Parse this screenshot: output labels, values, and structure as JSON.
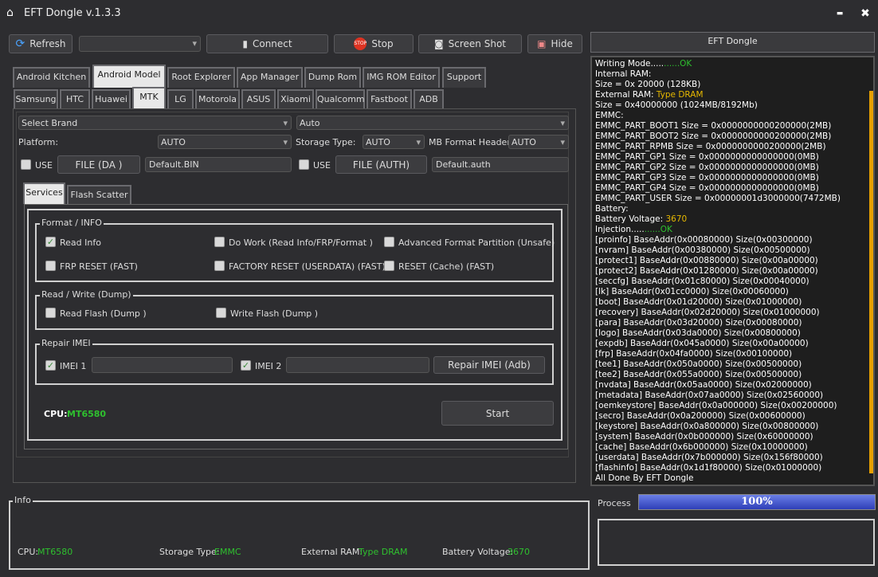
{
  "app": {
    "title": "EFT Dongle  v.1.3.3",
    "minimize": "▬",
    "close": "✖"
  },
  "toolbar": {
    "refresh": "Refresh",
    "port_value": "",
    "connect": "Connect",
    "stop": "Stop",
    "stop_icon_text": "STOP",
    "screenshot": "Screen Shot",
    "hide": "Hide"
  },
  "tabs": [
    "Android Kitchen",
    "Android Model",
    "Root Explorer",
    "App Manager",
    "Dump Rom",
    "IMG ROM Editor",
    "Support"
  ],
  "brand_tabs": [
    "Samsung",
    "HTC",
    "Huawei",
    "MTK",
    "LG",
    "Motorola",
    "ASUS",
    "Xiaomi",
    "Qualcomm",
    "Fastboot",
    "ADB"
  ],
  "form": {
    "brand": "Select Brand",
    "auto1": "Auto",
    "platform_label": "Platform:",
    "platform": "AUTO",
    "storage_label": "Storage Type:",
    "storage": "AUTO",
    "mbformat_label": "MB Format Header",
    "mbformat": "AUTO",
    "use1": "USE",
    "file_da": "FILE (DA )",
    "da_value": "Default.BIN",
    "use2": "USE",
    "file_auth": "FILE (AUTH)",
    "auth_value": "Default.auth"
  },
  "subtabs": [
    "Services",
    "Flash Scatter"
  ],
  "format": {
    "title": "Format / INFO",
    "read_info": "Read Info",
    "do_work": "Do Work (Read Info/FRP/Format )",
    "adv": "Advanced Format Partition (Unsafe)",
    "frp": "FRP RESET (FAST)",
    "factory": "FACTORY RESET (USERDATA) (FAST)",
    "reset": "RESET (Cache) (FAST)"
  },
  "rw": {
    "title": "Read / Write (Dump)",
    "read": "Read Flash (Dump )",
    "write": "Write Flash (Dump )"
  },
  "imei": {
    "title": "Repair IMEI",
    "imei1": "IMEI 1",
    "imei2": "IMEI 2",
    "repair": "Repair IMEI (Adb)"
  },
  "cpu": {
    "label": "CPU:",
    "value": "MT6580"
  },
  "start": "Start",
  "panel_title": "EFT Dongle",
  "log": [
    [
      "Writing Mode......",
      "",
      "......OK",
      "g"
    ],
    [
      "Internal RAM:",
      "",
      "",
      ""
    ],
    [
      "Size = 0x 20000 (128KB)",
      "",
      "",
      ""
    ],
    [
      "External RAM: ",
      "",
      "Type DRAM",
      "y"
    ],
    [
      "Size = 0x40000000 (1024MB/8192Mb)",
      "",
      "",
      ""
    ],
    [
      "EMMC:",
      "",
      "",
      ""
    ],
    [
      "EMMC_PART_BOOT1 Size = 0x0000000000200000(2MB)",
      "",
      "",
      ""
    ],
    [
      "EMMC_PART_BOOT2 Size = 0x0000000000200000(2MB)",
      "",
      "",
      ""
    ],
    [
      "EMMC_PART_RPMB Size = 0x0000000000200000(2MB)",
      "",
      "",
      ""
    ],
    [
      "EMMC_PART_GP1 Size = 0x0000000000000000(0MB)",
      "",
      "",
      ""
    ],
    [
      "EMMC_PART_GP2 Size = 0x0000000000000000(0MB)",
      "",
      "",
      ""
    ],
    [
      "EMMC_PART_GP3 Size = 0x0000000000000000(0MB)",
      "",
      "",
      ""
    ],
    [
      "EMMC_PART_GP4 Size = 0x0000000000000000(0MB)",
      "",
      "",
      ""
    ],
    [
      "EMMC_PART_USER Size = 0x00000001d3000000(7472MB)",
      "",
      "",
      ""
    ],
    [
      "Battery:",
      "",
      "",
      ""
    ],
    [
      "Battery Voltage: ",
      "",
      "3670",
      "y"
    ],
    [
      "Injection......",
      "",
      "......OK",
      "g"
    ],
    [
      "[proinfo] BaseAddr(0x00080000) Size(0x00300000)",
      "",
      "",
      ""
    ],
    [
      "[nvram] BaseAddr(0x00380000) Size(0x00500000)",
      "",
      "",
      ""
    ],
    [
      "[protect1] BaseAddr(0x00880000) Size(0x00a00000)",
      "",
      "",
      ""
    ],
    [
      "[protect2] BaseAddr(0x01280000) Size(0x00a00000)",
      "",
      "",
      ""
    ],
    [
      "[seccfg] BaseAddr(0x01c80000) Size(0x00040000)",
      "",
      "",
      ""
    ],
    [
      "[lk] BaseAddr(0x01cc0000) Size(0x00060000)",
      "",
      "",
      ""
    ],
    [
      "[boot] BaseAddr(0x01d20000) Size(0x01000000)",
      "",
      "",
      ""
    ],
    [
      "[recovery] BaseAddr(0x02d20000) Size(0x01000000)",
      "",
      "",
      ""
    ],
    [
      "[para] BaseAddr(0x03d20000) Size(0x00080000)",
      "",
      "",
      ""
    ],
    [
      "[logo] BaseAddr(0x03da0000) Size(0x00800000)",
      "",
      "",
      ""
    ],
    [
      "[expdb] BaseAddr(0x045a0000) Size(0x00a00000)",
      "",
      "",
      ""
    ],
    [
      "[frp] BaseAddr(0x04fa0000) Size(0x00100000)",
      "",
      "",
      ""
    ],
    [
      "[tee1] BaseAddr(0x050a0000) Size(0x00500000)",
      "",
      "",
      ""
    ],
    [
      "[tee2] BaseAddr(0x055a0000) Size(0x00500000)",
      "",
      "",
      ""
    ],
    [
      "[nvdata] BaseAddr(0x05aa0000) Size(0x02000000)",
      "",
      "",
      ""
    ],
    [
      "[metadata] BaseAddr(0x07aa0000) Size(0x02560000)",
      "",
      "",
      ""
    ],
    [
      "[oemkeystore] BaseAddr(0x0a000000) Size(0x00200000)",
      "",
      "",
      ""
    ],
    [
      "[secro] BaseAddr(0x0a200000) Size(0x00600000)",
      "",
      "",
      ""
    ],
    [
      "[keystore] BaseAddr(0x0a800000) Size(0x00800000)",
      "",
      "",
      ""
    ],
    [
      "[system] BaseAddr(0x0b000000) Size(0x60000000)",
      "",
      "",
      ""
    ],
    [
      "[cache] BaseAddr(0x6b000000) Size(0x10000000)",
      "",
      "",
      ""
    ],
    [
      "[userdata] BaseAddr(0x7b000000) Size(0x156f80000)",
      "",
      "",
      ""
    ],
    [
      "[flashinfo] BaseAddr(0x1d1f80000) Size(0x01000000)",
      "",
      "",
      ""
    ],
    [
      "All Done By EFT Dongle",
      "",
      "",
      ""
    ]
  ],
  "process": {
    "label": "Process",
    "percent": 100,
    "text": "100%"
  },
  "info": {
    "title": "Info",
    "cpu_label": "CPU:",
    "cpu": "MT6580",
    "storage_label": "Storage Type:",
    "storage": "EMMC",
    "ram_label": "External RAM: ",
    "ram": "Type DRAM",
    "batt_label": "Battery Voltage: ",
    "batt": "3670"
  },
  "colors": {
    "ok": "#2ec02e",
    "warn": "#e6b800",
    "progress": "#3a4fc8"
  }
}
